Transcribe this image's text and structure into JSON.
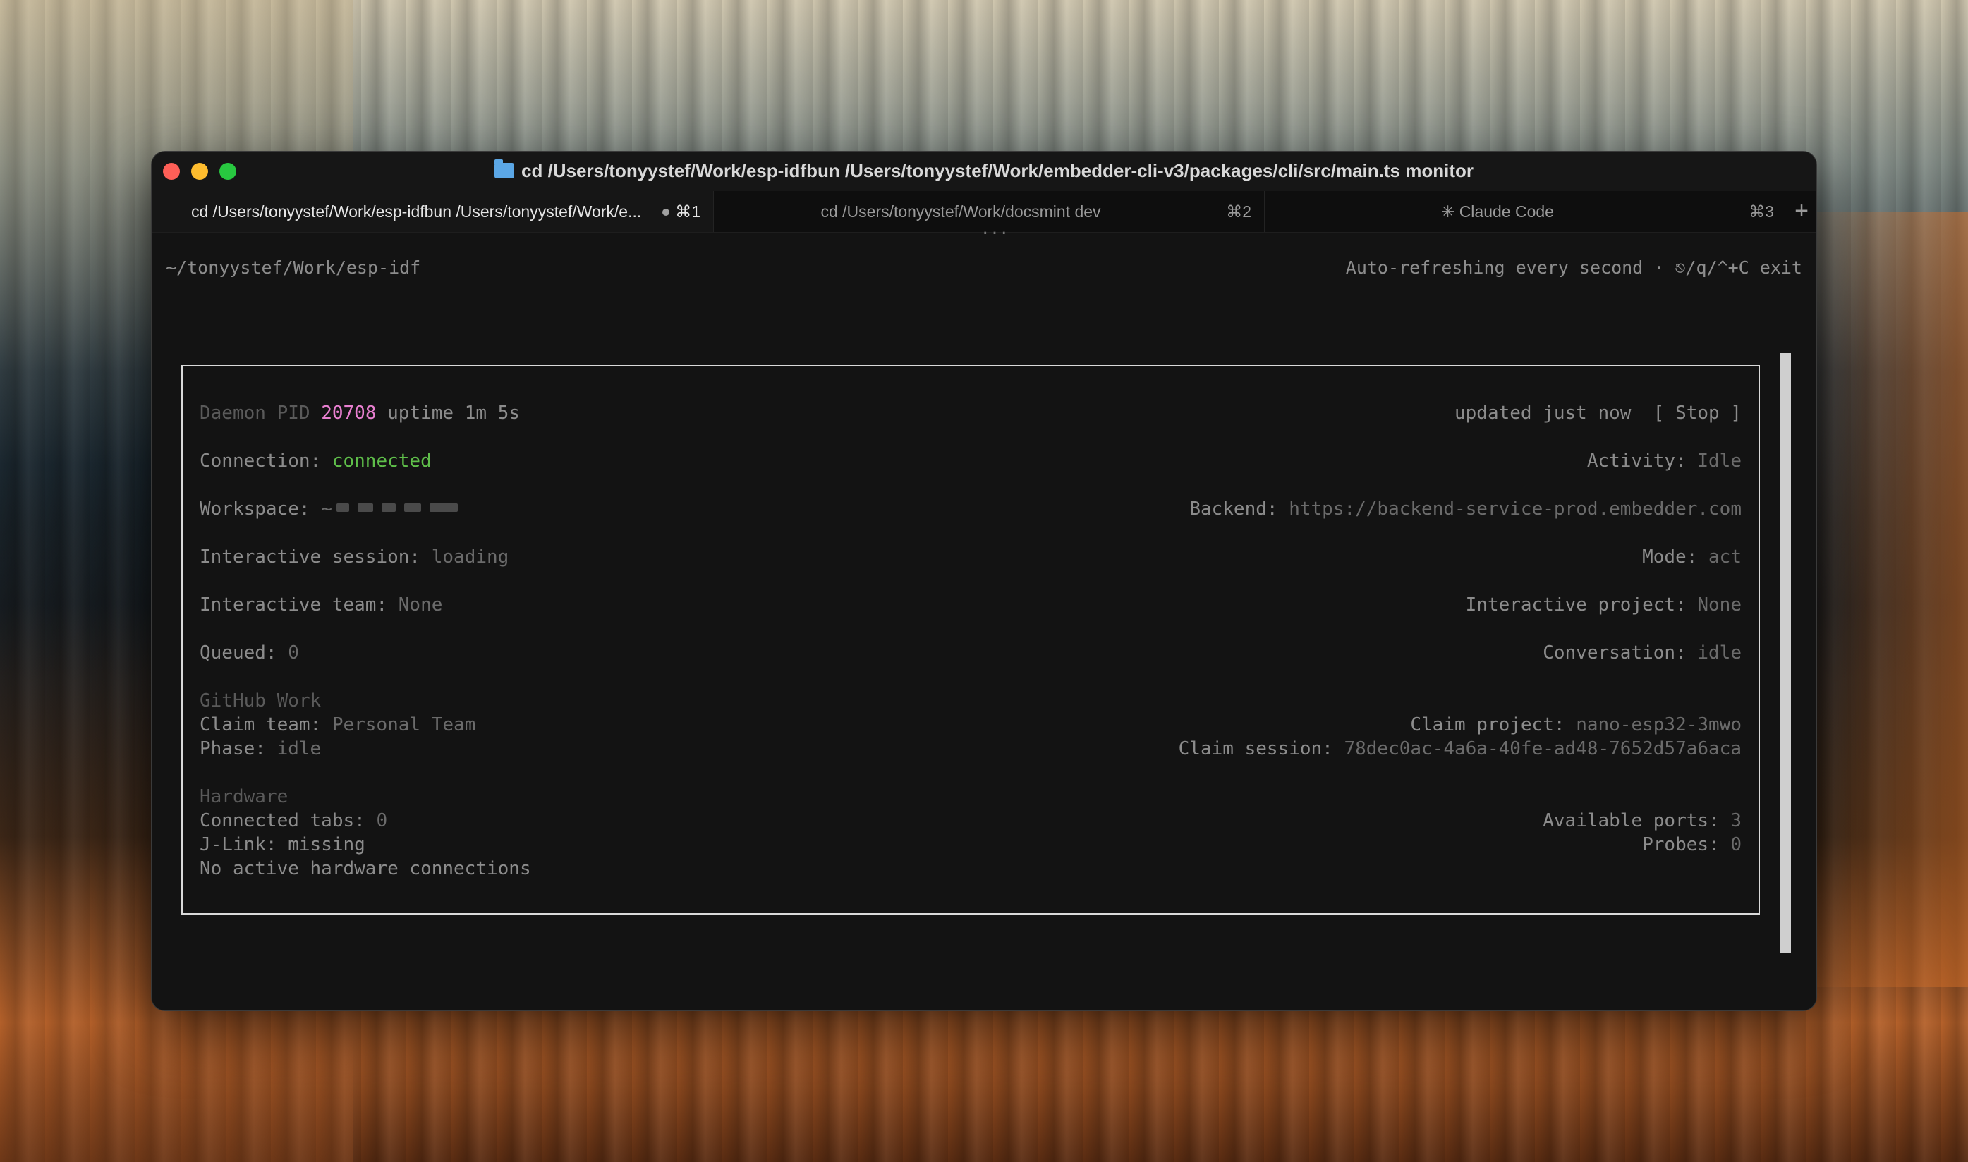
{
  "window": {
    "title": "cd /Users/tonyystef/Work/esp-idfbun /Users/tonyystef/Work/embedder-cli-v3/packages/cli/src/main.ts monitor"
  },
  "tabs": [
    {
      "label": "cd /Users/tonyystef/Work/esp-idfbun /Users/tonyystef/Work/e...",
      "shortcut": "⌘1",
      "active": true
    },
    {
      "label": "cd /Users/tonyystef/Work/docsmint dev",
      "shortcut": "⌘2",
      "active": false
    },
    {
      "label": "✳ Claude Code",
      "shortcut": "⌘3",
      "active": false
    }
  ],
  "tab_add": "+",
  "tab_overflow": "...",
  "terminal": {
    "cwd": "~/tonyystef/Work/esp-idf",
    "refresh_note": "Auto-refreshing every second · ⎋/q/^+C exit"
  },
  "monitor": {
    "daemon_label": "Daemon PID",
    "daemon_pid": "20708",
    "uptime_label": "uptime",
    "uptime_value": "1m 5s",
    "updated": "updated just now",
    "stop_button": "[ Stop ]",
    "connection_label": "Connection:",
    "connection_value": "connected",
    "activity_label": "Activity:",
    "activity_value": "Idle",
    "workspace_label": "Workspace:",
    "workspace_value": "~",
    "backend_label": "Backend:",
    "backend_value": "https://backend-service-prod.embedder.com",
    "interactive_session_label": "Interactive session:",
    "interactive_session_value": "loading",
    "mode_label": "Mode:",
    "mode_value": "act",
    "interactive_team_label": "Interactive team:",
    "interactive_team_value": "None",
    "interactive_project_label": "Interactive project:",
    "interactive_project_value": "None",
    "queued_label": "Queued:",
    "queued_value": "0",
    "conversation_label": "Conversation:",
    "conversation_value": "idle",
    "github_section": "GitHub Work",
    "claim_team_label": "Claim team:",
    "claim_team_value": "Personal Team",
    "claim_project_label": "Claim project:",
    "claim_project_value": "nano-esp32-3mwo",
    "phase_label": "Phase:",
    "phase_value": "idle",
    "claim_session_label": "Claim session:",
    "claim_session_value": "78dec0ac-4a6a-40fe-ad48-7652d57a6aca",
    "hardware_section": "Hardware",
    "connected_tabs_label": "Connected tabs:",
    "connected_tabs_value": "0",
    "available_ports_label": "Available ports:",
    "available_ports_value": "3",
    "jlink_label": "J-Link:",
    "jlink_value": "missing",
    "probes_label": "Probes:",
    "probes_value": "0",
    "no_hw": "No active hardware connections"
  }
}
